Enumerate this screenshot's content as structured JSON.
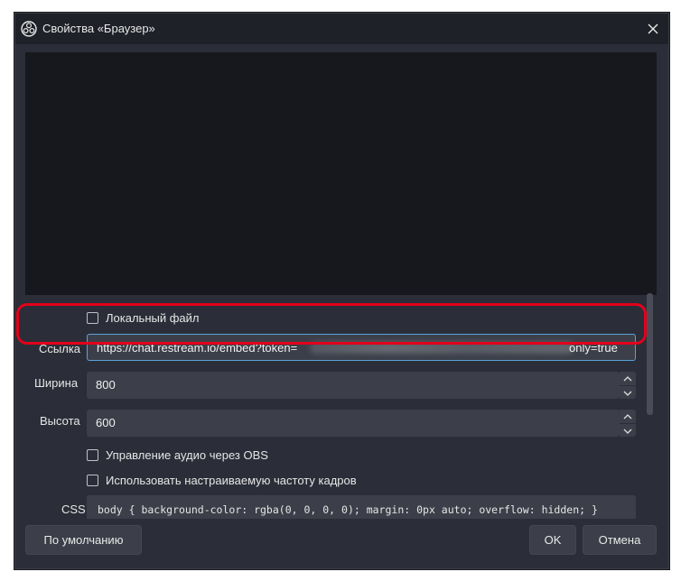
{
  "window": {
    "title": "Свойства «Браузер»"
  },
  "form": {
    "local_file_label": "Локальный файл",
    "url_label": "Ссылка",
    "url_prefix": "https://chat.restream.io/embed?token=",
    "url_suffix": "only=true",
    "width_label": "Ширина",
    "width_value": "800",
    "height_label": "Высота",
    "height_value": "600",
    "audio_control_label": "Управление аудио через OBS",
    "custom_fps_label": "Использовать настраиваемую частоту кадров",
    "css_label": "CSS",
    "css_value": "body { background-color: rgba(0, 0, 0, 0); margin: 0px auto; overflow: hidden; }"
  },
  "buttons": {
    "defaults": "По умолчанию",
    "ok": "OK",
    "cancel": "Отмена"
  },
  "colors": {
    "highlight": "#e3001b",
    "background": "#2b2e38",
    "field": "#3c3f49"
  }
}
